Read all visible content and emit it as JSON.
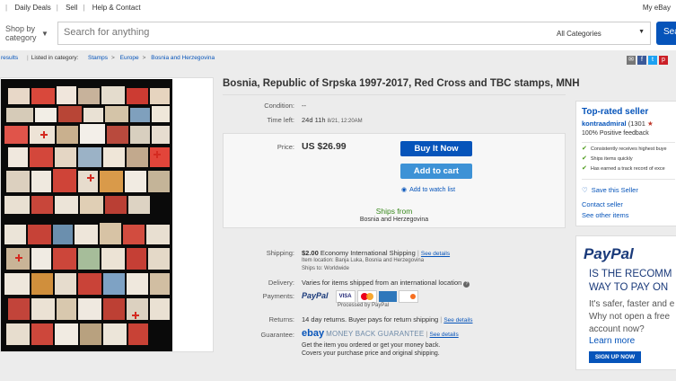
{
  "topbar": {
    "left_sep": "|",
    "daily_deals": "Daily Deals",
    "sell": "Sell",
    "help": "Help & Contact",
    "my_ebay": "My eBay"
  },
  "search": {
    "shop_by_line1": "Shop by",
    "shop_by_line2": "category",
    "placeholder": "Search for anything",
    "category": "All Categories",
    "button": "Sea"
  },
  "breadcrumb": {
    "back": "results",
    "listed": "Listed in category:",
    "items": [
      "Stamps",
      "Europe",
      "Bosnia and Herzegovina"
    ]
  },
  "listing": {
    "title": "Bosnia, Republic of Srpska 1997-2017, Red Cross and TBC stamps, MNH",
    "condition_label": "Condition:",
    "condition_value": "--",
    "time_left_label": "Time left:",
    "time_left_value": "24d 11h",
    "time_left_end": "8/21, 12:20AM",
    "price_label": "Price:",
    "price_value": "US $26.99",
    "buy_now": "Buy It Now",
    "add_to_cart": "Add to cart",
    "watch": "Add to watch list",
    "ships_from": "Ships from",
    "ships_from_location": "Bosnia and Herzegovina",
    "shipping_label": "Shipping:",
    "shipping_cost": "$2.00",
    "shipping_method": "Economy International Shipping",
    "see_details": "See details",
    "item_location": "Item location:   Banja Luka, Bosnia and Herzegovina",
    "ships_to": "Ships to:   Worldwide",
    "delivery_label": "Delivery:",
    "delivery_value": "Varies for items shipped from an international location",
    "payments_label": "Payments:",
    "paypal": "PayPal",
    "processed_by": "Processed by PayPal",
    "returns_label": "Returns:",
    "returns_value": "14 day returns. Buyer pays for return shipping",
    "guarantee_label": "Guarantee:",
    "guarantee_ebay": "ebay",
    "guarantee_mbg": "MONEY BACK GUARANTEE",
    "guarantee_line1": "Get the item you ordered or get your money back.",
    "guarantee_line2": "Covers your purchase price and original shipping."
  },
  "seller": {
    "badge": "Top-rated seller",
    "name": "kontraadmiral",
    "score": "(1301",
    "feedback": "100% Positive feedback",
    "points": [
      "Consistently receives highest buye",
      "Ships items quickly",
      "Has earned a track record of exce"
    ],
    "save": "Save this Seller",
    "contact": "Contact seller",
    "other": "See other items"
  },
  "ad": {
    "brand": "PayPal",
    "line1": "IS THE RECOMM",
    "line2": "WAY TO PAY ON",
    "line3": "It's safer, faster and e",
    "line4": "Why not open a free",
    "line5": "account now?",
    "learn": "Learn more",
    "signup": "SIGN UP NOW"
  },
  "colors": {
    "link": "#0654ba",
    "buy_button": "#0654ba",
    "cart_button": "#3d92d6",
    "ships_green": "#3a8a1e"
  }
}
